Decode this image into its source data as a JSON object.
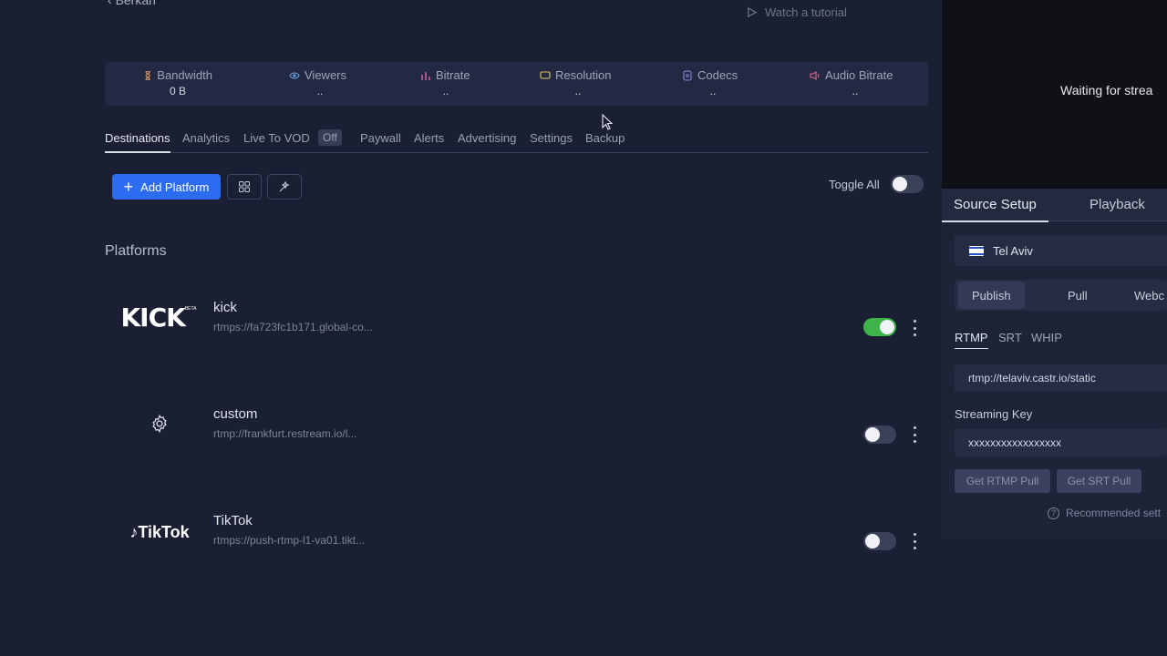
{
  "header": {
    "back_label": "Berkan",
    "tutorial_label": "Watch a tutorial"
  },
  "stats": [
    {
      "label": "Bandwidth",
      "value": "0 B",
      "icon": "hourglass-icon",
      "color": "#e0a06a"
    },
    {
      "label": "Viewers",
      "value": "..",
      "icon": "eye-icon",
      "color": "#6aa3e0"
    },
    {
      "label": "Bitrate",
      "value": "..",
      "icon": "bars-icon",
      "color": "#d86aa8"
    },
    {
      "label": "Resolution",
      "value": "..",
      "icon": "screen-icon",
      "color": "#e0c66a"
    },
    {
      "label": "Codecs",
      "value": "..",
      "icon": "codec-icon",
      "color": "#8a8ae0"
    },
    {
      "label": "Audio Bitrate",
      "value": "..",
      "icon": "speaker-icon",
      "color": "#e06a8a"
    }
  ],
  "tabs": [
    "Destinations",
    "Analytics",
    "Live To VOD",
    "Paywall",
    "Alerts",
    "Advertising",
    "Settings",
    "Backup"
  ],
  "vod_badge": "Off",
  "toolbar": {
    "add_platform": "Add Platform",
    "toggle_all": "Toggle All",
    "toggle_all_on": false
  },
  "platforms_title": "Platforms",
  "platforms": [
    {
      "name": "kick",
      "url": "rtmps://fa723fc1b171.global-co...",
      "enabled": true,
      "logo": "KICK",
      "logo_badge": "BETA"
    },
    {
      "name": "custom",
      "url": "rtmp://frankfurt.restream.io/l...",
      "enabled": false,
      "logo": ""
    },
    {
      "name": "TikTok",
      "url": "rtmps://push-rtmp-l1-va01.tikt...",
      "enabled": false,
      "logo": "TikTok"
    }
  ],
  "preview": {
    "status_text": "Waiting for strea"
  },
  "side_panel": {
    "tabs": [
      "Source Setup",
      "Playback"
    ],
    "region": "Tel Aviv",
    "modes": [
      "Publish",
      "Pull",
      "Webc"
    ],
    "protocols": [
      "RTMP",
      "SRT",
      "WHIP"
    ],
    "server_url": "rtmp://telaviv.castr.io/static",
    "stream_key_label": "Streaming Key",
    "stream_key": "xxxxxxxxxxxxxxxxx",
    "pull_buttons": [
      "Get RTMP Pull",
      "Get SRT Pull"
    ],
    "recommended": "Recommended sett"
  }
}
